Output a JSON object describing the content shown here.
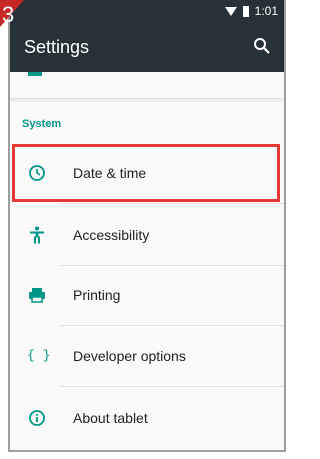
{
  "step": {
    "number": "3"
  },
  "status_bar": {
    "time": "1:01"
  },
  "app_bar": {
    "title": "Settings"
  },
  "section": {
    "header": "System"
  },
  "items": [
    {
      "label": "Date & time",
      "icon": "clock-icon"
    },
    {
      "label": "Accessibility",
      "icon": "accessibility-icon"
    },
    {
      "label": "Printing",
      "icon": "printer-icon"
    },
    {
      "label": "Developer options",
      "icon": "code-braces-icon",
      "glyph": "{ }"
    },
    {
      "label": "About tablet",
      "icon": "info-icon"
    }
  ],
  "colors": {
    "app_bar": "#263238",
    "accent": "#009688",
    "highlight": "#e53935",
    "step_badge": "#c62828"
  }
}
